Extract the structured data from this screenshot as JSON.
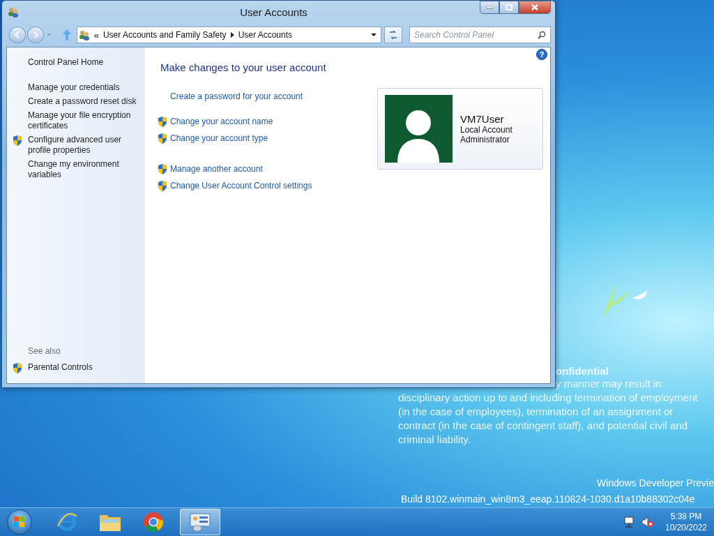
{
  "window": {
    "title": "User Accounts"
  },
  "address_bar": {
    "prefix": "«",
    "crumbs": [
      "User Accounts and Family Safety",
      "User Accounts"
    ]
  },
  "search": {
    "placeholder": "Search Control Panel"
  },
  "help": "?",
  "sidebar": {
    "home": "Control Panel Home",
    "tasks": [
      {
        "label": "Manage your credentials",
        "shield": false
      },
      {
        "label": "Create a password reset disk",
        "shield": false
      },
      {
        "label": "Manage your file encryption certificates",
        "shield": false
      },
      {
        "label": "Configure advanced user profile properties",
        "shield": true
      },
      {
        "label": "Change my environment variables",
        "shield": false
      }
    ],
    "see_also_title": "See also",
    "see_also": [
      {
        "label": "Parental Controls",
        "shield": true
      }
    ]
  },
  "main": {
    "heading": "Make changes to your user account",
    "link_groups": [
      [
        {
          "label": "Create a password for your account",
          "shield": false
        },
        {
          "label": "Change your account name",
          "shield": true
        },
        {
          "label": "Change your account type",
          "shield": true
        }
      ],
      [
        {
          "label": "Manage another account",
          "shield": true
        },
        {
          "label": "Change User Account Control settings",
          "shield": true
        }
      ]
    ]
  },
  "account": {
    "name": "VM7User",
    "type": "Local Account",
    "role": "Administrator"
  },
  "desktop": {
    "notice_lines": [
      "onfidential",
      "y manner may result in",
      "disciplinary action up to and including termination of employment",
      "(in the case of employees), termination of an assignment or",
      "contract (in the case of contingent staff), and potential civil and",
      "criminal liability."
    ],
    "edition": "Windows Developer Previe",
    "build": "Build 8102.winmain_win8m3_eeap.110824-1030.d1a10b88302c04e"
  },
  "taskbar": {
    "apps": [
      {
        "kind": "ie",
        "selected": false
      },
      {
        "kind": "explorer",
        "selected": false
      },
      {
        "kind": "chrome",
        "selected": false
      },
      {
        "kind": "control",
        "selected": true
      }
    ],
    "time": "5:38 PM",
    "date": "10/20/2022"
  }
}
